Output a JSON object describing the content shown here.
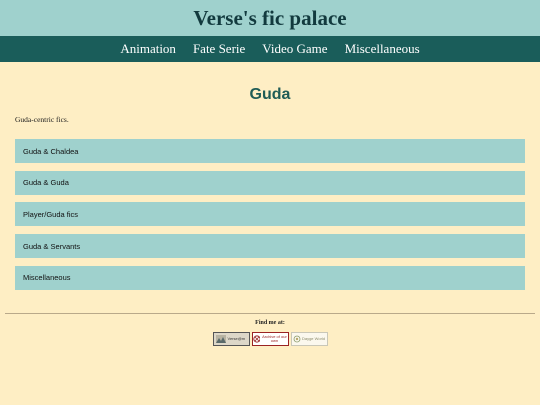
{
  "site": {
    "title": "Verse's fic palace"
  },
  "nav": {
    "items": [
      {
        "label": "Animation"
      },
      {
        "label": "Fate Serie"
      },
      {
        "label": "Video Game"
      },
      {
        "label": "Miscellaneous"
      }
    ]
  },
  "page": {
    "title": "Guda",
    "intro": "Guda-centric fics."
  },
  "categories": [
    {
      "label": "Guda & Chaldea"
    },
    {
      "label": "Guda & Guda"
    },
    {
      "label": "Player/Guda fics"
    },
    {
      "label": "Guda & Servants"
    },
    {
      "label": "Miscellaneous"
    }
  ],
  "footer": {
    "find_me": "Find me at:",
    "badges": [
      {
        "text": "Verse@m",
        "icon": "landscape-icon"
      },
      {
        "text": "Archive of our own",
        "icon": "ao3-logo-icon"
      },
      {
        "text": "Dayge World",
        "icon": "dreamwidth-icon"
      }
    ]
  },
  "colors": {
    "background": "#feeec4",
    "header": "#9fd1cd",
    "nav": "#1a5d5a",
    "list_item": "#9fd1cd",
    "title": "#1f5c56"
  }
}
